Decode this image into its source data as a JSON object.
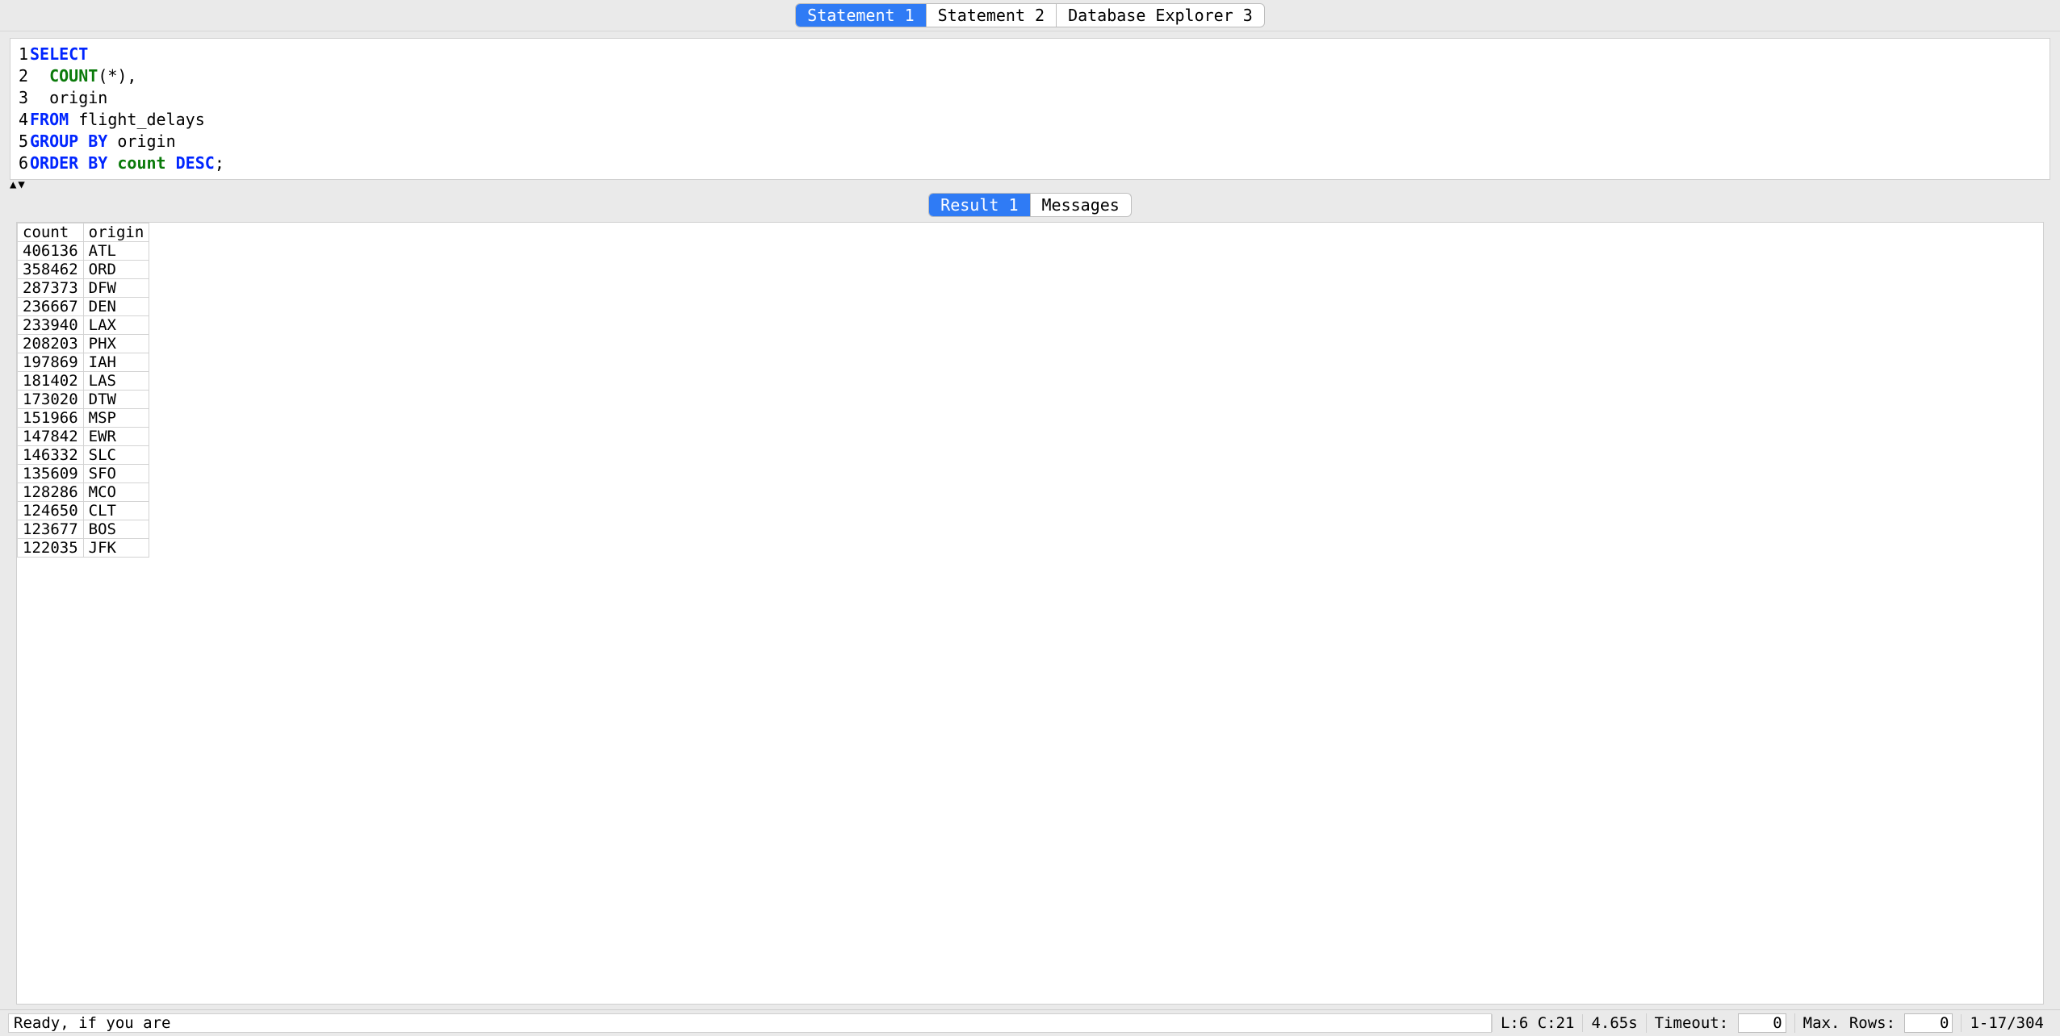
{
  "tabs": {
    "items": [
      {
        "label": "Statement 1",
        "active": true,
        "name": "tab-statement-1"
      },
      {
        "label": "Statement 2",
        "active": false,
        "name": "tab-statement-2"
      },
      {
        "label": "Database Explorer 3",
        "active": false,
        "name": "tab-database-explorer-3"
      }
    ]
  },
  "editor": {
    "lines": [
      {
        "n": "1",
        "tokens": [
          {
            "t": "SELECT",
            "c": "kw"
          }
        ]
      },
      {
        "n": "2",
        "tokens": [
          {
            "t": "  ",
            "c": "id"
          },
          {
            "t": "COUNT",
            "c": "fn"
          },
          {
            "t": "(*),",
            "c": "pun"
          }
        ]
      },
      {
        "n": "3",
        "tokens": [
          {
            "t": "  origin",
            "c": "id"
          }
        ]
      },
      {
        "n": "4",
        "tokens": [
          {
            "t": "FROM",
            "c": "kw"
          },
          {
            "t": " flight_delays",
            "c": "id"
          }
        ]
      },
      {
        "n": "5",
        "tokens": [
          {
            "t": "GROUP BY",
            "c": "kw"
          },
          {
            "t": " origin",
            "c": "id"
          }
        ]
      },
      {
        "n": "6",
        "tokens": [
          {
            "t": "ORDER BY",
            "c": "kw"
          },
          {
            "t": " ",
            "c": "id"
          },
          {
            "t": "count",
            "c": "fn"
          },
          {
            "t": " ",
            "c": "id"
          },
          {
            "t": "DESC",
            "c": "kw"
          },
          {
            "t": ";",
            "c": "pun"
          }
        ]
      }
    ]
  },
  "result_tabs": {
    "items": [
      {
        "label": "Result 1",
        "active": true,
        "name": "tab-result-1"
      },
      {
        "label": "Messages",
        "active": false,
        "name": "tab-messages"
      }
    ]
  },
  "results": {
    "columns": [
      "count",
      "origin"
    ],
    "rows": [
      [
        "406136",
        "ATL"
      ],
      [
        "358462",
        "ORD"
      ],
      [
        "287373",
        "DFW"
      ],
      [
        "236667",
        "DEN"
      ],
      [
        "233940",
        "LAX"
      ],
      [
        "208203",
        "PHX"
      ],
      [
        "197869",
        "IAH"
      ],
      [
        "181402",
        "LAS"
      ],
      [
        "173020",
        "DTW"
      ],
      [
        "151966",
        "MSP"
      ],
      [
        "147842",
        "EWR"
      ],
      [
        "146332",
        "SLC"
      ],
      [
        "135609",
        "SFO"
      ],
      [
        "128286",
        "MCO"
      ],
      [
        "124650",
        "CLT"
      ],
      [
        "123677",
        "BOS"
      ],
      [
        "122035",
        "JFK"
      ]
    ]
  },
  "status": {
    "message": "Ready, if you are",
    "cursor": "L:6 C:21",
    "time": "4.65s",
    "timeout_label": "Timeout:",
    "timeout_value": "0",
    "maxrows_label": "Max. Rows:",
    "maxrows_value": "0",
    "rowrange": "1-17/304"
  },
  "splitter": {
    "glyph": "▲▼"
  }
}
